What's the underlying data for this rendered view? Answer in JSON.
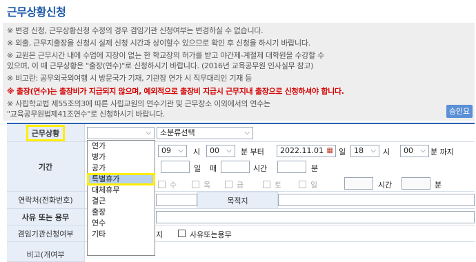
{
  "title": "근무상황신청",
  "notices": [
    {
      "text": "※ 변경 신청, 근무상황신청 수정의 경우 겸임기관 신청여부는 변경하실 수 없습니다.",
      "red": false
    },
    {
      "text": "※ 외출, 근무지출장을 신청시 실제 신청 시간과 상이할수 있으므로 확인 후 신청을 하시기 바랍니다.",
      "red": false
    },
    {
      "text": "※ 교원은 근무시간 내에 수업에 지장이 없는 한 학교장의 허가를 받고 야간제-계절제 대학원을 수강할 수",
      "red": false
    },
    {
      "text": "있으며, 이 때 근무상황은 \"출장(연수)\"로 신청하시기 바랍니다. (2016년 교육공무원 인사실무 참고)",
      "red": false
    },
    {
      "text": "※ 비고란: 공무외국외여행 시 방문국가 기재, 기관장 연가 시 직무대리인 기재 등",
      "red": false
    },
    {
      "text": "※ 출장(연수)는 출장비가 지급되지 않으며, 예외적으로 출장비 지급시 근무지내 출장으로 신청하셔야 합니다.",
      "red": true
    },
    {
      "text": "※ 사립학교법 제55조의3에 따른 사립교원의 연수기관 및 근무장소 이외에서의 연수는",
      "red": false
    },
    {
      "text": "\"교육공무원법제41조연수\"로 신청하시기 바랍니다.",
      "red": false
    }
  ],
  "approve_button": "승인요청",
  "labels": {
    "status": "근무상황",
    "period": "기간",
    "contact": "연락처(전화번호)",
    "destination": "목적지",
    "reason": "사유 또는 용무",
    "dual": "겸임기관신청여부",
    "remark": "비고(개여부"
  },
  "status_select": {
    "value": ""
  },
  "subcat_select": {
    "value": "소분류선택"
  },
  "period": {
    "start_hour": "09",
    "hour_unit": "시",
    "start_min": "00",
    "min_from": "분 부터",
    "end_date": "2022.11.01",
    "day_unit": "일",
    "end_hour": "18",
    "end_hour_unit": "시",
    "end_min": "00",
    "min_until": "분 까지",
    "days_unit": "일",
    "every": "매",
    "time_unit": "시간",
    "min_unit": "분",
    "weekdays": [
      "수",
      "목",
      "금",
      "토",
      "일"
    ],
    "time_unit2": "시간",
    "min_unit2": "분"
  },
  "dual_options": {
    "a": "지",
    "b": "사유또는용무"
  },
  "dropdown_options": [
    {
      "label": "연가",
      "active": false
    },
    {
      "label": "병가",
      "active": false
    },
    {
      "label": "공가",
      "active": false
    },
    {
      "label": "특별휴가",
      "active": true
    },
    {
      "label": "대체휴무",
      "active": false
    },
    {
      "label": "결근",
      "active": false
    },
    {
      "label": "출장",
      "active": false
    },
    {
      "label": "연수",
      "active": false
    },
    {
      "label": "기타",
      "active": false
    }
  ]
}
